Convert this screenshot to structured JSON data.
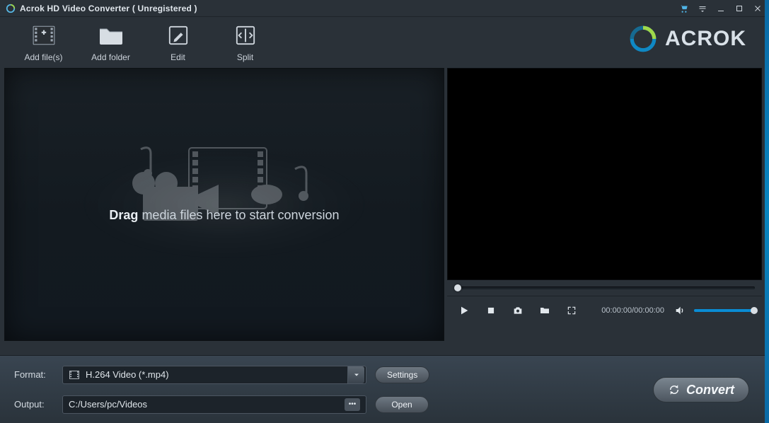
{
  "titlebar": {
    "title": "Acrok HD Video Converter ( Unregistered )"
  },
  "toolbar": {
    "add_files": "Add file(s)",
    "add_folder": "Add folder",
    "edit": "Edit",
    "split": "Split"
  },
  "brand": {
    "name": "ACROK"
  },
  "dropzone": {
    "drag_label_bold": "Drag",
    "drag_label_rest": " media files here to start conversion"
  },
  "player": {
    "timecode": "00:00:00/00:00:00"
  },
  "bottom": {
    "format_label": "Format:",
    "format_value": "H.264 Video (*.mp4)",
    "settings_label": "Settings",
    "output_label": "Output:",
    "output_path": "C:/Users/pc/Videos",
    "open_label": "Open",
    "browse_dots": "•••"
  },
  "convert": {
    "label": "Convert"
  }
}
